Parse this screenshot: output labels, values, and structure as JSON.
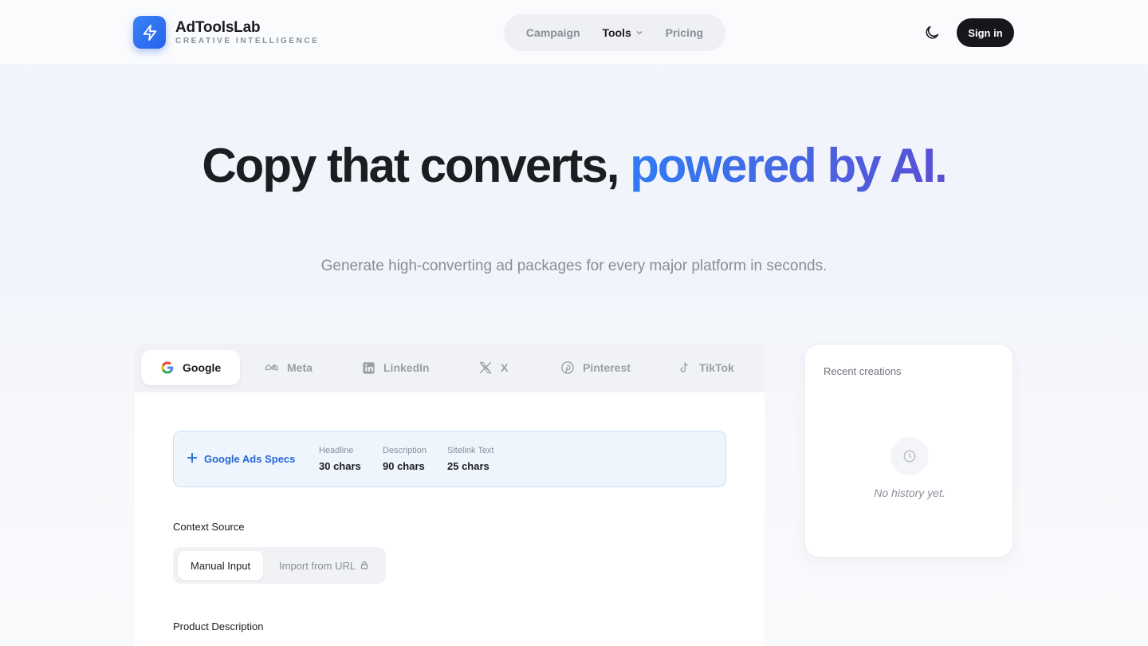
{
  "brand": {
    "name": "AdToolsLab",
    "tagline": "CREATIVE INTELLIGENCE"
  },
  "nav": {
    "items": [
      {
        "label": "Campaign"
      },
      {
        "label": "Tools"
      },
      {
        "label": "Pricing"
      }
    ]
  },
  "header": {
    "signin_label": "Sign in"
  },
  "hero": {
    "title_plain": "Copy that converts, ",
    "title_accent": "powered by AI.",
    "subtitle": "Generate high-converting ad packages for every major platform in seconds."
  },
  "platform_tabs": [
    {
      "label": "Google",
      "icon": "google-icon"
    },
    {
      "label": "Meta",
      "icon": "meta-icon"
    },
    {
      "label": "LinkedIn",
      "icon": "linkedin-icon"
    },
    {
      "label": "X",
      "icon": "x-icon"
    },
    {
      "label": "Pinterest",
      "icon": "pinterest-icon"
    },
    {
      "label": "TikTok",
      "icon": "tiktok-icon"
    }
  ],
  "specs": {
    "title": "Google Ads Specs",
    "items": [
      {
        "label": "Headline",
        "value": "30 chars"
      },
      {
        "label": "Description",
        "value": "90 chars"
      },
      {
        "label": "Sitelink Text",
        "value": "25 chars"
      }
    ]
  },
  "context": {
    "label": "Context Source",
    "options": [
      {
        "label": "Manual Input"
      },
      {
        "label": "Import from URL"
      }
    ]
  },
  "product": {
    "label": "Product Description"
  },
  "recent": {
    "title": "Recent creations",
    "empty": "No history yet."
  },
  "colors": {
    "accent": "#2563eb",
    "dark": "#16171b",
    "specs_bg": "#eef5fd"
  }
}
